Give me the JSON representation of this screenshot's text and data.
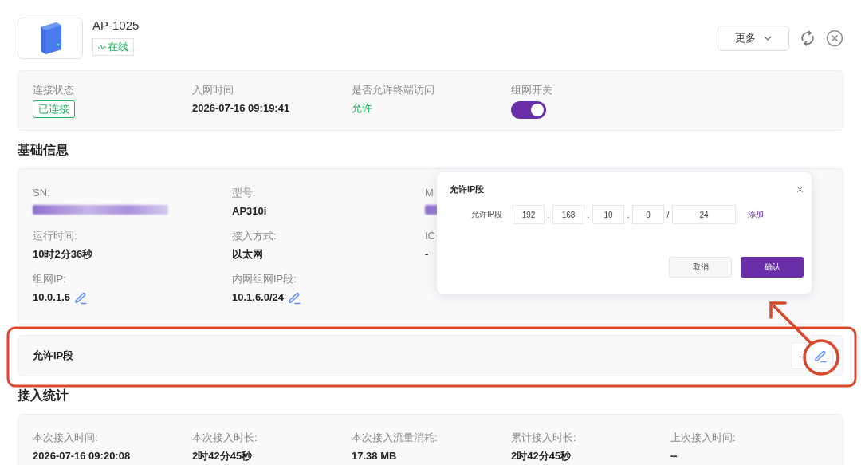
{
  "header": {
    "title": "AP-1025",
    "status": "在线",
    "more_button": "更多"
  },
  "status_card": {
    "items": [
      {
        "label": "连接状态",
        "value": "已连接",
        "kind": "tag"
      },
      {
        "label": "入网时间",
        "value": "2026-07-16 09:19:41",
        "kind": "text"
      },
      {
        "label": "是否允许终端访问",
        "value": "允许",
        "kind": "accent"
      },
      {
        "label": "组网开关",
        "kind": "switch",
        "on": true
      }
    ]
  },
  "basic_info": {
    "heading": "基础信息",
    "items": [
      {
        "label": "SN:",
        "kind": "redacted"
      },
      {
        "label": "型号:",
        "value": "AP310i",
        "kind": "text"
      },
      {
        "label": "M",
        "kind": "redacted"
      },
      {
        "label": "运行时间:",
        "value": "10时2分36秒",
        "kind": "text"
      },
      {
        "label": "接入方式:",
        "value": "以太网",
        "kind": "text"
      },
      {
        "label": "IC",
        "value": "-",
        "kind": "text"
      },
      {
        "label": "组网IP:",
        "value": "10.0.1.6",
        "kind": "editable"
      },
      {
        "label": "内网组网IP段:",
        "value": "10.1.6.0/24",
        "kind": "editable"
      }
    ]
  },
  "allowed_ip": {
    "label": "允许IP段",
    "value": "--"
  },
  "access_stats": {
    "heading": "接入统计",
    "items": [
      {
        "label": "本次接入时间:",
        "value": "2026-07-16 09:20:08"
      },
      {
        "label": "本次接入时长:",
        "value": "2时42分45秒"
      },
      {
        "label": "本次接入流量消耗:",
        "value": "17.38 MB"
      },
      {
        "label": "累计接入时长:",
        "value": "2时42分45秒"
      },
      {
        "label": "上次接入时间:",
        "value": "--"
      }
    ]
  },
  "dialog": {
    "title": "允许IP段",
    "field_label": "允许IP段",
    "octets": [
      "192",
      "168",
      "10",
      "0"
    ],
    "separators": [
      ".",
      ".",
      ".",
      "/"
    ],
    "prefix": "24",
    "add_link": "添加",
    "cancel_button": "取消",
    "confirm_button": "确认"
  }
}
